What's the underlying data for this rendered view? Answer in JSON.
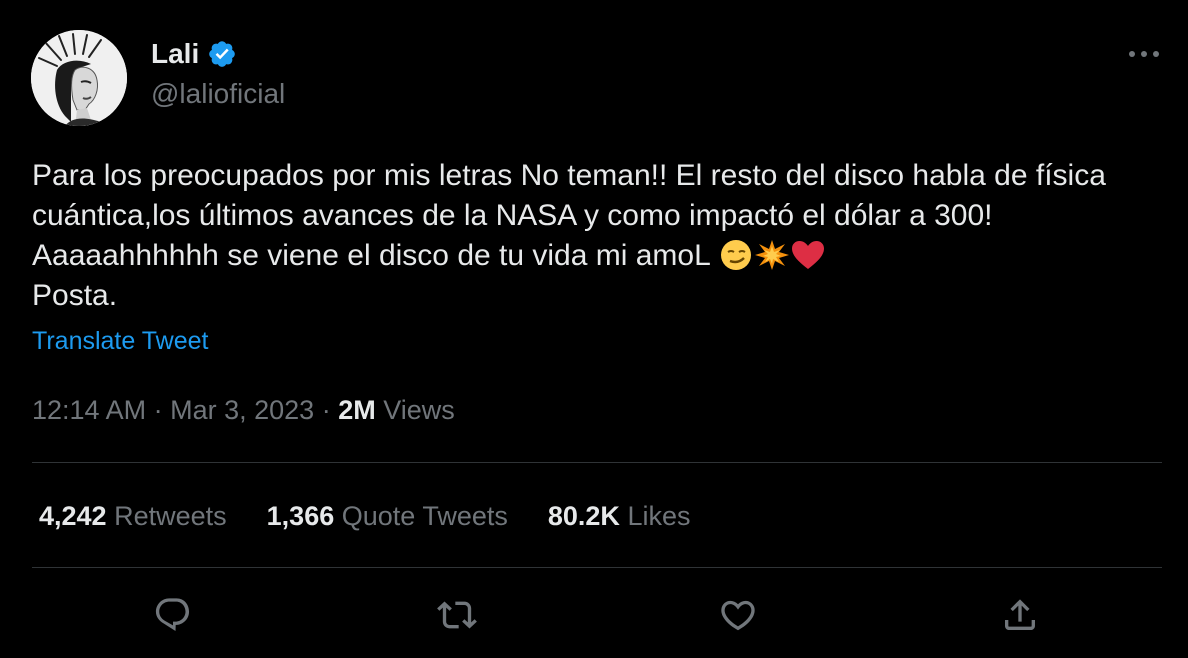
{
  "author": {
    "display_name": "Lali",
    "handle": "@lalioficial",
    "verified": true,
    "avatar_icon": "woman-crown-portrait"
  },
  "tweet": {
    "text_main": "Para los preocupados por mis letras No teman!! El resto del disco habla de física cuántica,los últimos avances de la NASA y como impactó el dólar a 300! Aaaaahhhhhh se viene el disco de tu vida mi amoL",
    "text_end": "Posta.",
    "emojis": [
      "smirking-face-emoji",
      "collision-emoji",
      "red-heart-emoji"
    ],
    "translate_label": "Translate Tweet",
    "time": "12:14 AM",
    "date": "Mar 3, 2023",
    "separator": "·",
    "views_count": "2M",
    "views_label": "Views"
  },
  "stats": {
    "retweets_count": "4,242",
    "retweets_label": "Retweets",
    "quotes_count": "1,366",
    "quotes_label": "Quote Tweets",
    "likes_count": "80.2K",
    "likes_label": "Likes"
  },
  "actions": [
    "reply-icon",
    "retweet-icon",
    "like-icon",
    "share-icon"
  ],
  "colors": {
    "background": "#000000",
    "text": "#e7e9ea",
    "secondary": "#71767b",
    "accent": "#1d9bf0",
    "divider": "#2f3336"
  }
}
